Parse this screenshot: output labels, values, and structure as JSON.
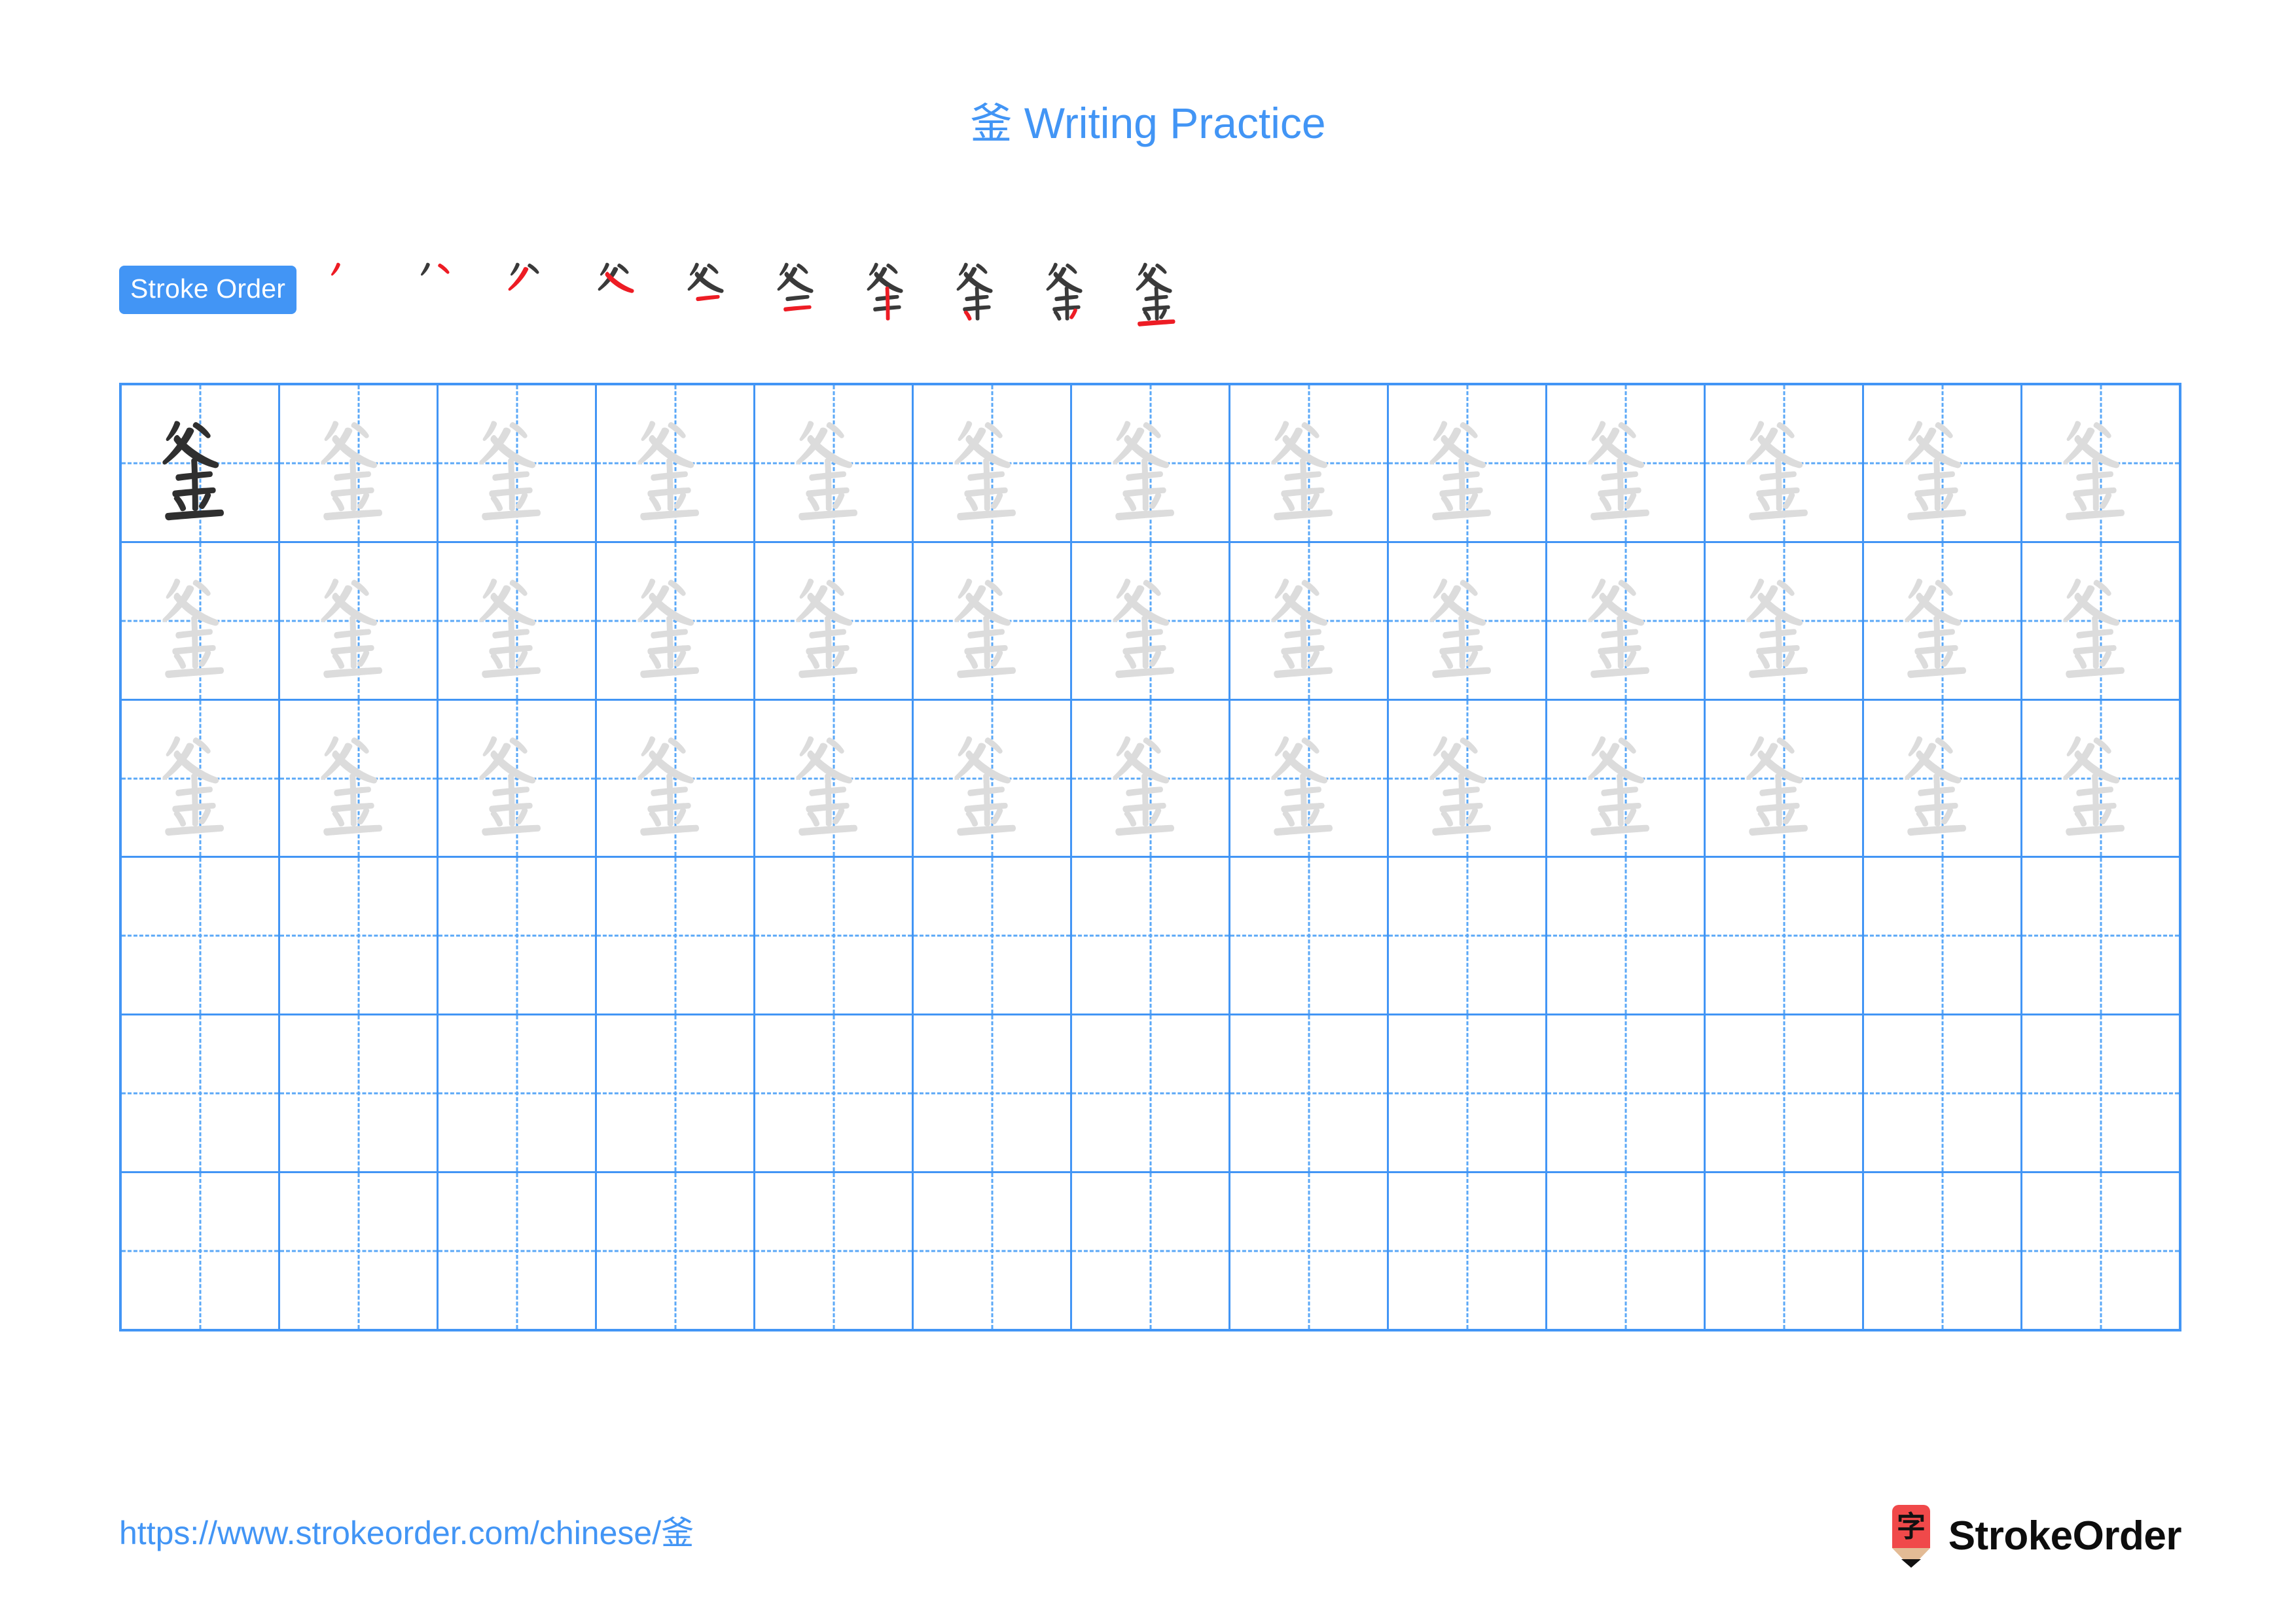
{
  "page": {
    "character": "釜",
    "title_suffix": " Writing Practice",
    "title_full": "釜 Writing Practice",
    "accent_color": "#4295f5",
    "model_glyph_color": "#2f2f2f",
    "trace_glyph_color": "#dcdcdc",
    "new_stroke_color": "#ed1c24",
    "old_stroke_color": "#3a3a3a"
  },
  "stroke_order": {
    "badge_label": "Stroke Order",
    "total_strokes": 10,
    "stages": [
      {
        "index": 1,
        "strokes_shown": 1,
        "new_stroke": "dot / left-falling (丿)"
      },
      {
        "index": 2,
        "strokes_shown": 2,
        "new_stroke": "right dot (丶)"
      },
      {
        "index": 3,
        "strokes_shown": 3,
        "new_stroke": "left-falling (丿)"
      },
      {
        "index": 4,
        "strokes_shown": 4,
        "new_stroke": "right-falling (捺)"
      },
      {
        "index": 5,
        "strokes_shown": 5,
        "new_stroke": "horizontal (一)"
      },
      {
        "index": 6,
        "strokes_shown": 6,
        "new_stroke": "horizontal (一)"
      },
      {
        "index": 7,
        "strokes_shown": 7,
        "new_stroke": "vertical (丨)"
      },
      {
        "index": 8,
        "strokes_shown": 8,
        "new_stroke": "left dot (丶)"
      },
      {
        "index": 9,
        "strokes_shown": 9,
        "new_stroke": "right dot (丶)"
      },
      {
        "index": 10,
        "strokes_shown": 10,
        "new_stroke": "bottom horizontal (一)"
      }
    ]
  },
  "grid": {
    "columns": 13,
    "rows": 6,
    "cells": [
      [
        "model",
        "trace",
        "trace",
        "trace",
        "trace",
        "trace",
        "trace",
        "trace",
        "trace",
        "trace",
        "trace",
        "trace",
        "trace"
      ],
      [
        "trace",
        "trace",
        "trace",
        "trace",
        "trace",
        "trace",
        "trace",
        "trace",
        "trace",
        "trace",
        "trace",
        "trace",
        "trace"
      ],
      [
        "trace",
        "trace",
        "trace",
        "trace",
        "trace",
        "trace",
        "trace",
        "trace",
        "trace",
        "trace",
        "trace",
        "trace",
        "trace"
      ],
      [
        "empty",
        "empty",
        "empty",
        "empty",
        "empty",
        "empty",
        "empty",
        "empty",
        "empty",
        "empty",
        "empty",
        "empty",
        "empty"
      ],
      [
        "empty",
        "empty",
        "empty",
        "empty",
        "empty",
        "empty",
        "empty",
        "empty",
        "empty",
        "empty",
        "empty",
        "empty",
        "empty"
      ],
      [
        "empty",
        "empty",
        "empty",
        "empty",
        "empty",
        "empty",
        "empty",
        "empty",
        "empty",
        "empty",
        "empty",
        "empty",
        "empty"
      ]
    ]
  },
  "footer": {
    "url": "https://www.strokeorder.com/chinese/釜",
    "brand_name": "StrokeOrder",
    "brand_mark_character": "字",
    "brand_mark_color": "#f0494a",
    "brand_tip_color": "#e3bb95"
  }
}
